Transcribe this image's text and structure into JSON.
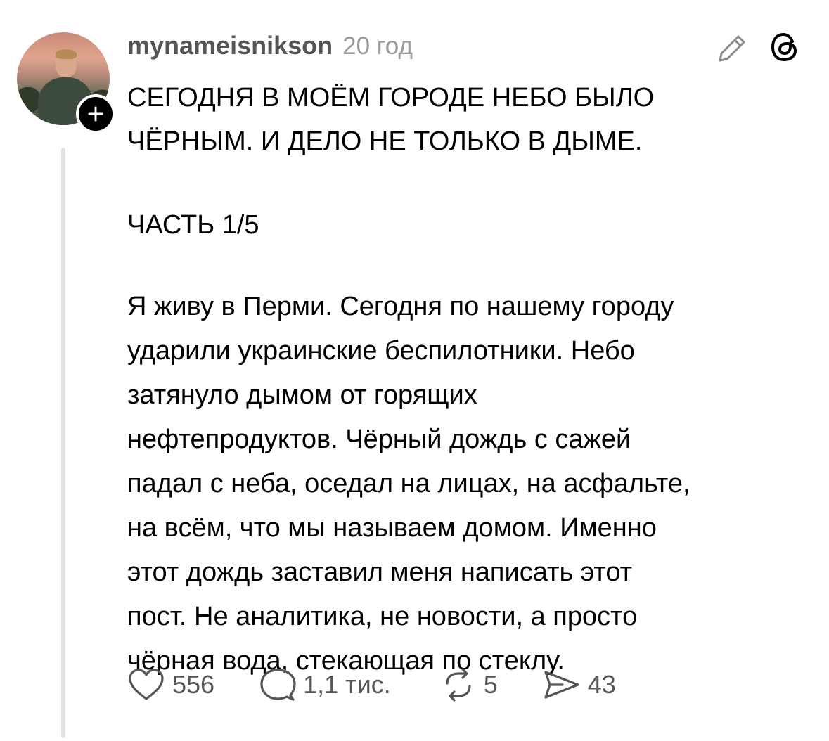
{
  "post": {
    "username": "mynameisnikson",
    "timestamp": "20 год",
    "heading_line1": "СЕГОДНЯ В МОЁМ ГОРОДЕ НЕБО БЫЛО",
    "heading_line2": "ЧЁРНЫМ. И ДЕЛО НЕ ТОЛЬКО В ДЫМЕ.",
    "part": "ЧАСТЬ 1/5",
    "body_lines": [
      "Я живу в Перми. Сегодня по нашему городу",
      "ударили украинские беспилотники. Небо",
      "затянуло дымом от горящих",
      "нефтепродуктов. Чёрный дождь с сажей",
      "падал с неба, оседал на лицах, на асфальте,",
      "на всём, что мы называем домом. Именно",
      "этот дождь заставил меня написать этот",
      "пост. Не аналитика, не новости, а просто",
      "чёрная вода, стекающая по стеклу."
    ]
  },
  "stats": {
    "likes": "556",
    "comments": "1,1 тис.",
    "reposts": "5",
    "shares": "43"
  },
  "icons": {
    "like": "heart-icon",
    "comment": "comment-bubble-icon",
    "repost": "repost-arrows-icon",
    "share": "paper-plane-icon",
    "edit": "pencil-icon",
    "app": "threads-logo-icon"
  },
  "colors": {
    "text": "#000000",
    "secondary": "#555555",
    "muted": "#9a9a9a",
    "thread_line": "#e3e3e3"
  }
}
